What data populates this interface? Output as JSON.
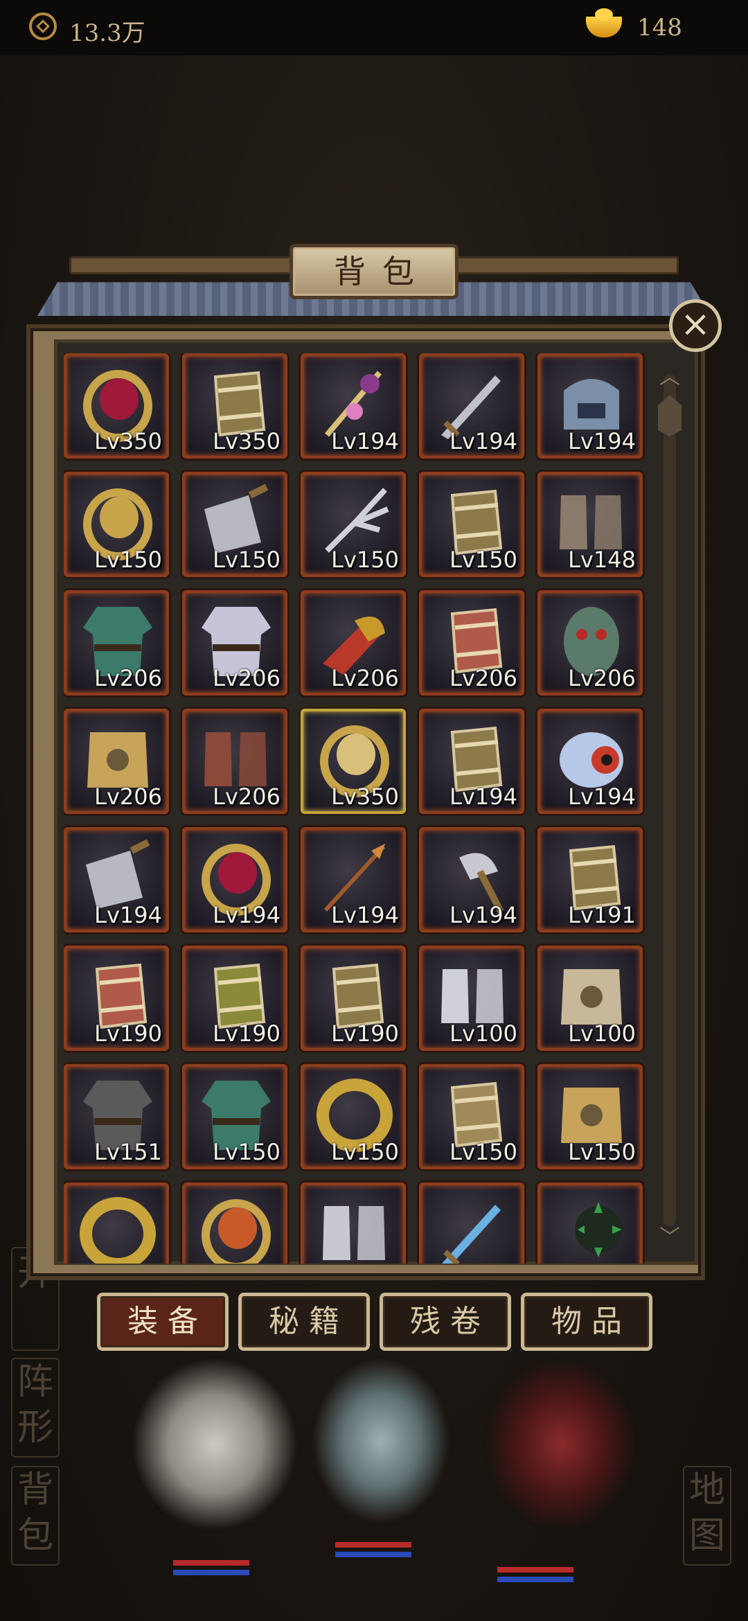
{
  "topbar": {
    "coin_icon": "copper-coin-icon",
    "money": "13.3万",
    "gold_icon": "gold-ingot-icon",
    "gold": "148"
  },
  "panel": {
    "title": "背包",
    "close_icon": "close-icon"
  },
  "items": [
    {
      "icon": "ring-icon",
      "level": "Lv350",
      "tint": "#a0183a"
    },
    {
      "icon": "bracer-icon",
      "level": "Lv350",
      "tint": "#8c7a4a"
    },
    {
      "icon": "staff-icon",
      "level": "Lv194",
      "tint": "#8a3a8a"
    },
    {
      "icon": "sword-icon",
      "level": "Lv194",
      "tint": "#c0c0c8"
    },
    {
      "icon": "helmet-icon",
      "level": "Lv194",
      "tint": "#7c8fa8"
    },
    {
      "icon": "ring-icon",
      "level": "Lv150",
      "tint": "#c8a44a"
    },
    {
      "icon": "cleaver-icon",
      "level": "Lv150",
      "tint": "#b8b8c0"
    },
    {
      "icon": "claw-icon",
      "level": "Lv150",
      "tint": "#d0d0d8"
    },
    {
      "icon": "bracer-icon",
      "level": "Lv150",
      "tint": "#8c7a4a"
    },
    {
      "icon": "boots-icon",
      "level": "Lv148",
      "tint": "#8a7a6a"
    },
    {
      "icon": "robe-icon",
      "level": "Lv206",
      "tint": "#3c7a6a"
    },
    {
      "icon": "robe-icon",
      "level": "Lv206",
      "tint": "#c8c4d8"
    },
    {
      "icon": "gauntlet-icon",
      "level": "Lv206",
      "tint": "#c89a2a"
    },
    {
      "icon": "bracer-icon",
      "level": "Lv206",
      "tint": "#b05a4a"
    },
    {
      "icon": "mask-icon",
      "level": "Lv206",
      "tint": "#5a7a6a"
    },
    {
      "icon": "armor-icon",
      "level": "Lv206",
      "tint": "#c8a45a"
    },
    {
      "icon": "boots-icon",
      "level": "Lv206",
      "tint": "#8a4a3a"
    },
    {
      "icon": "ring-icon",
      "level": "Lv350",
      "tint": "#d8c07a",
      "highlight": true
    },
    {
      "icon": "bracer-icon",
      "level": "Lv194",
      "tint": "#8c7a4a"
    },
    {
      "icon": "amulet-icon",
      "level": "Lv194",
      "tint": "#c83a2a"
    },
    {
      "icon": "cleaver-icon",
      "level": "Lv194",
      "tint": "#b8b8c0"
    },
    {
      "icon": "ring-icon",
      "level": "Lv194",
      "tint": "#a0183a"
    },
    {
      "icon": "spear-icon",
      "level": "Lv194",
      "tint": "#a05a2a"
    },
    {
      "icon": "axe-icon",
      "level": "Lv194",
      "tint": "#c8c8d0"
    },
    {
      "icon": "bracer-icon",
      "level": "Lv191",
      "tint": "#8c7a4a"
    },
    {
      "icon": "bracer-icon",
      "level": "Lv190",
      "tint": "#b05a4a"
    },
    {
      "icon": "bracer-icon",
      "level": "Lv190",
      "tint": "#8a8a3a"
    },
    {
      "icon": "bracer-icon",
      "level": "Lv190",
      "tint": "#8c7a4a"
    },
    {
      "icon": "boots-icon",
      "level": "Lv100",
      "tint": "#d0d0d8"
    },
    {
      "icon": "armor-icon",
      "level": "Lv100",
      "tint": "#c8b89a"
    },
    {
      "icon": "robe-icon",
      "level": "Lv151",
      "tint": "#5a5a5a"
    },
    {
      "icon": "robe-icon",
      "level": "Lv150",
      "tint": "#3c7a6a"
    },
    {
      "icon": "bangle-icon",
      "level": "Lv150",
      "tint": "#c8a43a"
    },
    {
      "icon": "bracer-icon",
      "level": "Lv150",
      "tint": "#a08a5a"
    },
    {
      "icon": "armor-icon",
      "level": "Lv150",
      "tint": "#c8a45a"
    },
    {
      "icon": "bangle-icon",
      "level": "",
      "tint": "#c8a43a"
    },
    {
      "icon": "ring-icon",
      "level": "",
      "tint": "#c85a2a"
    },
    {
      "icon": "boots-icon",
      "level": "",
      "tint": "#c8c8d0"
    },
    {
      "icon": "sword-icon",
      "level": "",
      "tint": "#6ab0e0"
    },
    {
      "icon": "mace-icon",
      "level": "",
      "tint": "#3aa04a"
    }
  ],
  "tabs": [
    {
      "label": "装备",
      "active": true
    },
    {
      "label": "秘籍",
      "active": false
    },
    {
      "label": "残卷",
      "active": false
    },
    {
      "label": "物品",
      "active": false
    }
  ],
  "side_tags": {
    "left": [
      "开",
      "阵形",
      "背包"
    ],
    "right": "地图"
  }
}
